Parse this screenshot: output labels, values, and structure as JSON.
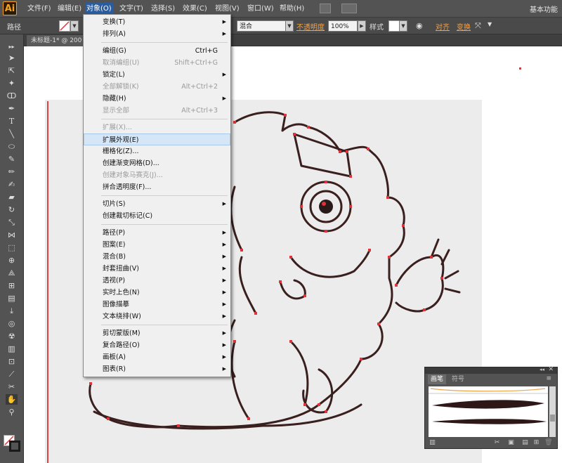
{
  "app": {
    "logo": "Ai",
    "workspace": "基本功能"
  },
  "menubar": {
    "items": [
      {
        "label": "文件(F)"
      },
      {
        "label": "编辑(E)"
      },
      {
        "label": "对象(O)"
      },
      {
        "label": "文字(T)"
      },
      {
        "label": "选择(S)"
      },
      {
        "label": "效果(C)"
      },
      {
        "label": "视图(V)"
      },
      {
        "label": "窗口(W)"
      },
      {
        "label": "帮助(H)"
      }
    ],
    "active_index": 2
  },
  "control_bar": {
    "selection_label": "路径",
    "blend_mode": "混合",
    "opacity_label": "不透明度",
    "opacity_value": "100%",
    "style_label": "样式",
    "align_label": "对齐",
    "transform_label": "变换"
  },
  "document_tab": {
    "label": "未标题-1* @ 200"
  },
  "object_menu": {
    "items": [
      {
        "label": "变换(T)",
        "shortcut": "",
        "submenu": true,
        "disabled": false
      },
      {
        "label": "排列(A)",
        "shortcut": "",
        "submenu": true,
        "disabled": false
      },
      {
        "label": "编组(G)",
        "shortcut": "Ctrl+G",
        "submenu": false,
        "disabled": false
      },
      {
        "label": "取消编组(U)",
        "shortcut": "Shift+Ctrl+G",
        "submenu": false,
        "disabled": true
      },
      {
        "label": "锁定(L)",
        "shortcut": "",
        "submenu": true,
        "disabled": false
      },
      {
        "label": "全部解锁(K)",
        "shortcut": "Alt+Ctrl+2",
        "submenu": false,
        "disabled": true
      },
      {
        "label": "隐藏(H)",
        "shortcut": "",
        "submenu": true,
        "disabled": false
      },
      {
        "label": "显示全部",
        "shortcut": "Alt+Ctrl+3",
        "submenu": false,
        "disabled": true
      },
      {
        "label": "扩展(X)...",
        "shortcut": "",
        "submenu": false,
        "disabled": true
      },
      {
        "label": "扩展外观(E)",
        "shortcut": "",
        "submenu": false,
        "disabled": false,
        "highlighted": true
      },
      {
        "label": "栅格化(Z)...",
        "shortcut": "",
        "submenu": false,
        "disabled": false
      },
      {
        "label": "创建渐变网格(D)...",
        "shortcut": "",
        "submenu": false,
        "disabled": false
      },
      {
        "label": "创建对象马赛克(J)...",
        "shortcut": "",
        "submenu": false,
        "disabled": true
      },
      {
        "label": "拼合透明度(F)...",
        "shortcut": "",
        "submenu": false,
        "disabled": false
      },
      {
        "label": "切片(S)",
        "shortcut": "",
        "submenu": true,
        "disabled": false
      },
      {
        "label": "创建裁切标记(C)",
        "shortcut": "",
        "submenu": false,
        "disabled": false
      },
      {
        "label": "路径(P)",
        "shortcut": "",
        "submenu": true,
        "disabled": false
      },
      {
        "label": "图案(E)",
        "shortcut": "",
        "submenu": true,
        "disabled": false
      },
      {
        "label": "混合(B)",
        "shortcut": "",
        "submenu": true,
        "disabled": false
      },
      {
        "label": "封套扭曲(V)",
        "shortcut": "",
        "submenu": true,
        "disabled": false
      },
      {
        "label": "透视(P)",
        "shortcut": "",
        "submenu": true,
        "disabled": false
      },
      {
        "label": "实时上色(N)",
        "shortcut": "",
        "submenu": true,
        "disabled": false
      },
      {
        "label": "图像描摹",
        "shortcut": "",
        "submenu": true,
        "disabled": false
      },
      {
        "label": "文本绕排(W)",
        "shortcut": "",
        "submenu": true,
        "disabled": false
      },
      {
        "label": "剪切蒙版(M)",
        "shortcut": "",
        "submenu": true,
        "disabled": false
      },
      {
        "label": "复合路径(O)",
        "shortcut": "",
        "submenu": true,
        "disabled": false
      },
      {
        "label": "画板(A)",
        "shortcut": "",
        "submenu": true,
        "disabled": false
      },
      {
        "label": "图表(R)",
        "shortcut": "",
        "submenu": true,
        "disabled": false
      }
    ]
  },
  "brushes_panel": {
    "tabs": [
      "画笔",
      "符号"
    ],
    "active_tab": 0
  },
  "colors": {
    "menubar_bg": "#535353",
    "menu_active": "#2a5d9f",
    "dropdown_bg": "#f0f0f0",
    "highlight_bg": "#d5e6f7",
    "accent_orange": "#f0a24a",
    "path_red": "#e0323a",
    "stroke_dark": "#3a1f1f"
  }
}
